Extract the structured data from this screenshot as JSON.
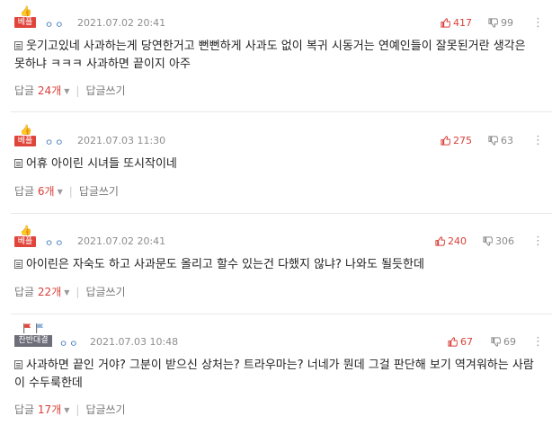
{
  "comments": [
    {
      "badge": "베플",
      "date": "2021.07.02 20:41",
      "likes": "417",
      "dislikes": "99",
      "text_line1": "웃기고있네 사과하는게 당연한거고 뻔뻔하게 사과도 없이 복귀 시동거는 연예인들이 잘못된거란 생각은",
      "text_line2": "못하냐 ㅋㅋㅋ 사과하면 끝이지 아주",
      "reply_label": "답글",
      "reply_count": "24개",
      "write_reply": "답글쓰기"
    },
    {
      "badge": "베플",
      "date": "2021.07.03 11:30",
      "likes": "275",
      "dislikes": "63",
      "text_line1": "어휴 아이린 시녀들 또시작이네",
      "reply_label": "답글",
      "reply_count": "6개",
      "write_reply": "답글쓰기"
    },
    {
      "badge": "베플",
      "date": "2021.07.02 20:41",
      "likes": "240",
      "dislikes": "306",
      "text_line1": "아이린은 자숙도 하고 사과문도 올리고 할수 있는건 다했지 않냐? 나와도 될듯한데",
      "reply_label": "답글",
      "reply_count": "22개",
      "write_reply": "답글쓰기"
    },
    {
      "badge": "찬반대결",
      "date": "2021.07.03 10:48",
      "likes": "67",
      "dislikes": "69",
      "text_line1": "사과하면 끝인 거야? 그분이 받으신 상처는? 트라우마는? 너네가 뭔데 그걸 판단해 보기 역겨워하는 사람",
      "text_line2": "이 수두룩한데",
      "reply_label": "답글",
      "reply_count": "17개",
      "write_reply": "답글쓰기"
    }
  ],
  "user_masked": "ㅇㅇ",
  "colors": {
    "up": "#d9403a",
    "down": "#8a8a8a",
    "badge_best": "#e0453b",
    "badge_versus": "#6e6e7a"
  },
  "icons": {
    "like": "thumb-up-icon",
    "dislike": "thumb-down-icon",
    "more": "more-vertical-icon",
    "text": "document-icon"
  }
}
